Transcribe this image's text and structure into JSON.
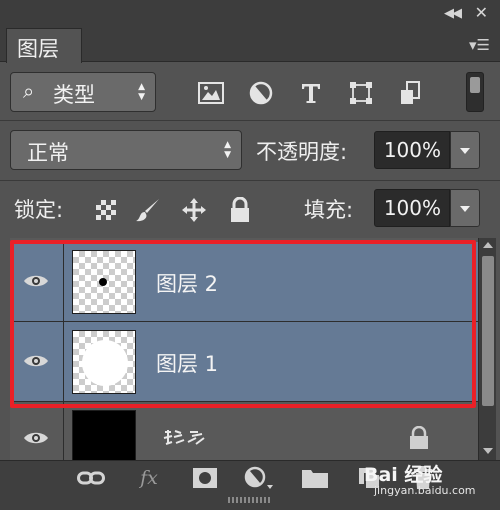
{
  "header": {
    "collapse_icon": "double-chevron-left-icon",
    "close_icon": "close-x-icon",
    "tab_label": "图层",
    "menu_icon": "panel-menu-icon"
  },
  "filter": {
    "kind_label": "类型",
    "icons": [
      "pixel-filter-icon",
      "adjustment-filter-icon",
      "type-filter-icon",
      "shape-filter-icon",
      "smart-object-filter-icon"
    ]
  },
  "blend": {
    "mode": "正常",
    "opacity_label": "不透明度:",
    "opacity_value": "100%"
  },
  "lock": {
    "label": "锁定:",
    "icons": [
      "lock-transparent-icon",
      "lock-image-icon",
      "lock-position-icon",
      "lock-all-icon"
    ],
    "fill_label": "填充:",
    "fill_value": "100%"
  },
  "layers": [
    {
      "name": "图层 2",
      "visible": true,
      "selected": true,
      "thumb": "transparent-with-dot"
    },
    {
      "name": "图层 1",
      "visible": true,
      "selected": true,
      "thumb": "transparent-with-white-circle"
    },
    {
      "name": "",
      "visible": true,
      "selected": false,
      "thumb": "black",
      "locked": true
    }
  ],
  "bottom_bar": {
    "icons": [
      "link-layers-icon",
      "fx-icon",
      "add-mask-icon",
      "adjustment-layer-icon",
      "new-group-icon",
      "new-layer-icon",
      "delete-layer-icon"
    ]
  },
  "watermark": {
    "main": "Bai 经验",
    "sub": "jingyan.baidu.com"
  },
  "colors": {
    "panel_bg": "#535353",
    "selected_row": "#657a95",
    "highlight_border": "#ea2027"
  }
}
